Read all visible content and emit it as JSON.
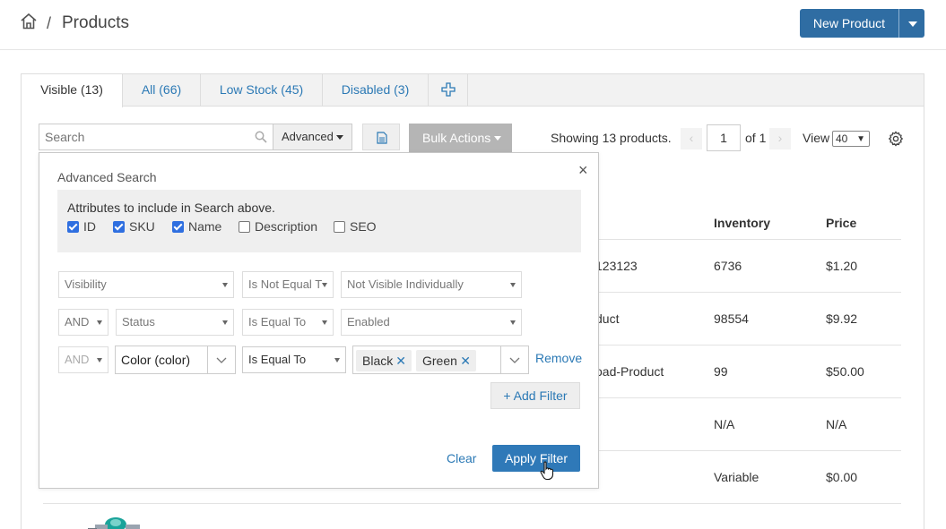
{
  "header": {
    "breadcrumb_sep": "/",
    "title": "Products",
    "new_product_label": "New Product"
  },
  "tabs": [
    {
      "label": "Visible (13)",
      "active": true
    },
    {
      "label": "All (66)"
    },
    {
      "label": "Low Stock (45)"
    },
    {
      "label": "Disabled (3)"
    }
  ],
  "toolbar": {
    "search_placeholder": "Search",
    "advanced_label": "Advanced",
    "bulk_actions_label": "Bulk Actions",
    "showing_text": "Showing 13 products.",
    "page_value": "1",
    "of_text": "of 1",
    "view_label": "View",
    "view_value": "40"
  },
  "table": {
    "headers": {
      "inventory": "Inventory",
      "price": "Price"
    },
    "rows": [
      {
        "name": "123123",
        "inventory": "6736",
        "price": "$1.20"
      },
      {
        "name": "duct",
        "inventory": "98554",
        "price": "$9.92"
      },
      {
        "name": "oad-Product",
        "inventory": "99",
        "price": "$50.00"
      },
      {
        "name": "",
        "inventory": "N/A",
        "price": "N/A"
      },
      {
        "name": "",
        "inventory": "Variable",
        "price": "$0.00"
      }
    ]
  },
  "advanced_search": {
    "title": "Advanced Search",
    "close": "×",
    "attributes_title": "Attributes to include in Search above.",
    "attributes": [
      {
        "label": "ID",
        "checked": true
      },
      {
        "label": "SKU",
        "checked": true
      },
      {
        "label": "Name",
        "checked": true
      },
      {
        "label": "Description",
        "checked": false
      },
      {
        "label": "SEO",
        "checked": false
      }
    ],
    "filters": [
      {
        "field": "Visibility",
        "operator": "Is Not Equal T",
        "value": "Not Visible Individually"
      },
      {
        "conj": "AND",
        "field": "Status",
        "operator": "Is Equal To",
        "value": "Enabled"
      },
      {
        "conj": "AND",
        "field": "Color (color)",
        "operator": "Is Equal To",
        "tags": [
          "Black",
          "Green"
        ]
      }
    ],
    "remove_label": "Remove",
    "add_filter_label": "+ Add Filter",
    "clear_label": "Clear",
    "apply_label": "Apply Filter"
  },
  "colors": {
    "primary": "#2f6da3",
    "link": "#2b79b5",
    "checkbox": "#2f6fe0"
  }
}
